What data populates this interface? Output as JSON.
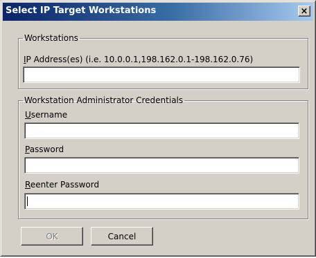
{
  "window": {
    "title": "Select IP Target Workstations",
    "close_glyph": "×"
  },
  "workstations_group": {
    "legend": "Workstations",
    "ip_label_prefix": "",
    "ip_label_underline": "I",
    "ip_label_rest": "P Address(es) (i.e. 10.0.0.1,198.162.0.1-198.162.0.76)",
    "ip_value": ""
  },
  "credentials_group": {
    "legend": "Workstation Administrator Credentials",
    "username_underline": "U",
    "username_rest": "sername",
    "username_value": "",
    "password_underline": "P",
    "password_rest": "assword",
    "password_value": "",
    "reenter_underline": "R",
    "reenter_rest": "eenter Password",
    "reenter_value": ""
  },
  "buttons": {
    "ok": "OK",
    "cancel": "Cancel"
  }
}
